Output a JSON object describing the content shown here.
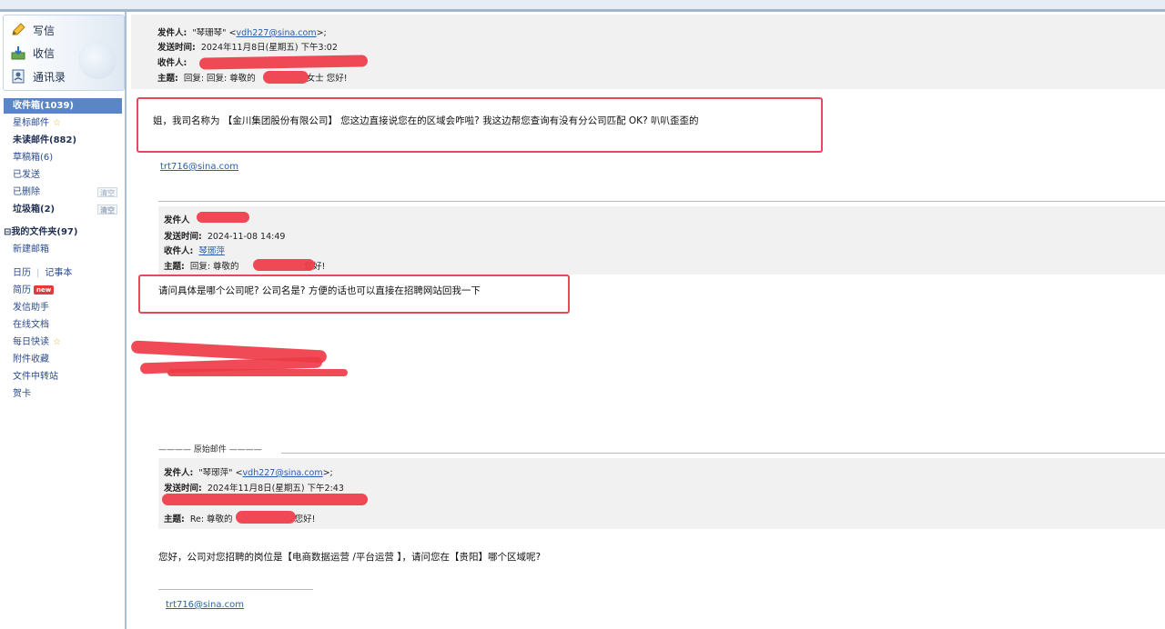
{
  "sidebar": {
    "quick": [
      {
        "label": "写信",
        "icon": "pencil-icon"
      },
      {
        "label": "收信",
        "icon": "inbox-arrow-icon"
      },
      {
        "label": "通讯录",
        "icon": "address-book-icon"
      }
    ],
    "folders": {
      "inbox": "收件箱(1039)",
      "starred": "星标邮件",
      "unread": "未读邮件(882)",
      "drafts": "草稿箱(6)",
      "sent": "已发送",
      "deleted": "已删除",
      "deleted_tag": "清空",
      "spam": "垃圾箱(2)",
      "spam_tag": "清空",
      "my_folders": "⊟我的文件夹(97)",
      "new_folder": "新建邮箱"
    },
    "tools": {
      "diary": "日历",
      "notebook": "记事本",
      "resume": "简历",
      "resume_badge": "new",
      "assistant": "发信助手",
      "online_docs": "在线文档",
      "daily_news": "每日快读",
      "attachments": "附件收藏",
      "transfer": "文件中转站",
      "card": "贺卡"
    }
  },
  "email1": {
    "from_label": "发件人:",
    "from_value": "\"琴珊琴\" <",
    "from_email": "vdh227@sina.com",
    "from_tail": ">;",
    "time_label": "发送时间:",
    "time_value": "2024年11月8日(星期五) 下午3:02",
    "to_label": "收件人:",
    "subject_label": "主题:",
    "subject_value": "回复: 回复:  尊敬的",
    "subject_tail": "女士 您好!",
    "body": "姐，我司名称为 【金川集团股份有限公司】 您这边直接说您在的区域会咋啦? 我这边帮您查询有没有分公司匹配 OK? 叭叭歪歪的",
    "signature": "trt716@sina.com"
  },
  "email2": {
    "from_label": "发件人",
    "time_label": "发送时间:",
    "time_value": "2024-11-08 14:49",
    "to_label": "收件人:",
    "to_value": "琴琊萍",
    "subject_label": "主题:",
    "subject_value": "回复:  尊敬的",
    "subject_tail": "您好!",
    "body": "请问具体是哪个公司呢? 公司名是? 方便的话也可以直接在招聘网站回我一下"
  },
  "original": {
    "divider_label": "———— 原始邮件 ————",
    "from_label": "发件人:",
    "from_value": "\"琴琊萍\" <",
    "from_email": "vdh227@sina.com",
    "from_tail": ">;",
    "time_label": "发送时间:",
    "time_value": "2024年11月8日(星期五) 下午2:43",
    "subject_label": "主题:",
    "subject_value": "Re: 尊敬的",
    "subject_tail": "您好!",
    "body": "您好，公司对您招聘的岗位是【电商数据运营 /平台运营 】，请问您在【贵阳】哪个区域呢?",
    "signature": "trt716@sina.com"
  },
  "colors": {
    "highlight_border": "#e64a5a",
    "redaction": "#ee3b46",
    "selected_folder": "#5b86c4",
    "link": "#2a5db0"
  }
}
